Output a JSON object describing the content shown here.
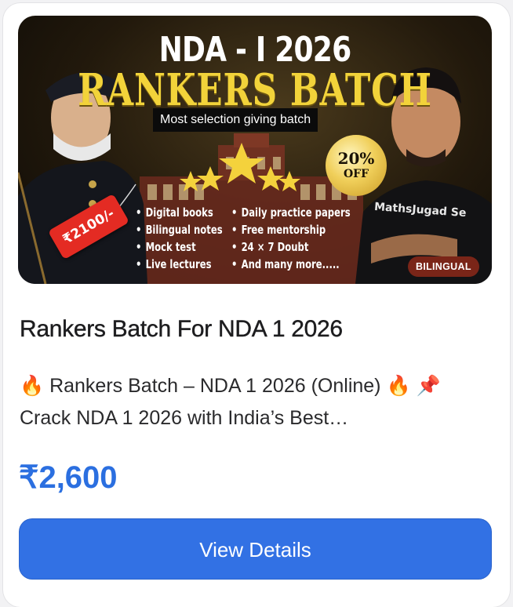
{
  "banner": {
    "title_line1": "NDA - I 2026",
    "title_line2": "RANKERS BATCH",
    "tagline": "Most selection giving batch",
    "discount_percent": "20%",
    "discount_word": "OFF",
    "price_tag": "₹2100/-",
    "features_left": [
      "Digital books",
      "Bilingual notes",
      "Mock test",
      "Live lectures"
    ],
    "features_right": [
      "Daily practice papers",
      "Free mentorship",
      "24 × 7 Doubt",
      "And many more....."
    ],
    "brand_text": "MathsJugad Se",
    "badge": "BILINGUAL"
  },
  "card": {
    "title": "Rankers Batch For NDA 1 2026",
    "description_line1": "🔥 Rankers Batch – NDA 1 2026 (Online) 🔥 📌",
    "description_line2": "Crack NDA 1 2026 with India’s Best…",
    "price": "₹2,600",
    "button_label": "View Details"
  },
  "colors": {
    "accent": "#3271e4",
    "price": "#2b6fe0",
    "banner_title": "#f2d33a",
    "price_tag": "#e42b23",
    "badge": "#7a2518"
  }
}
